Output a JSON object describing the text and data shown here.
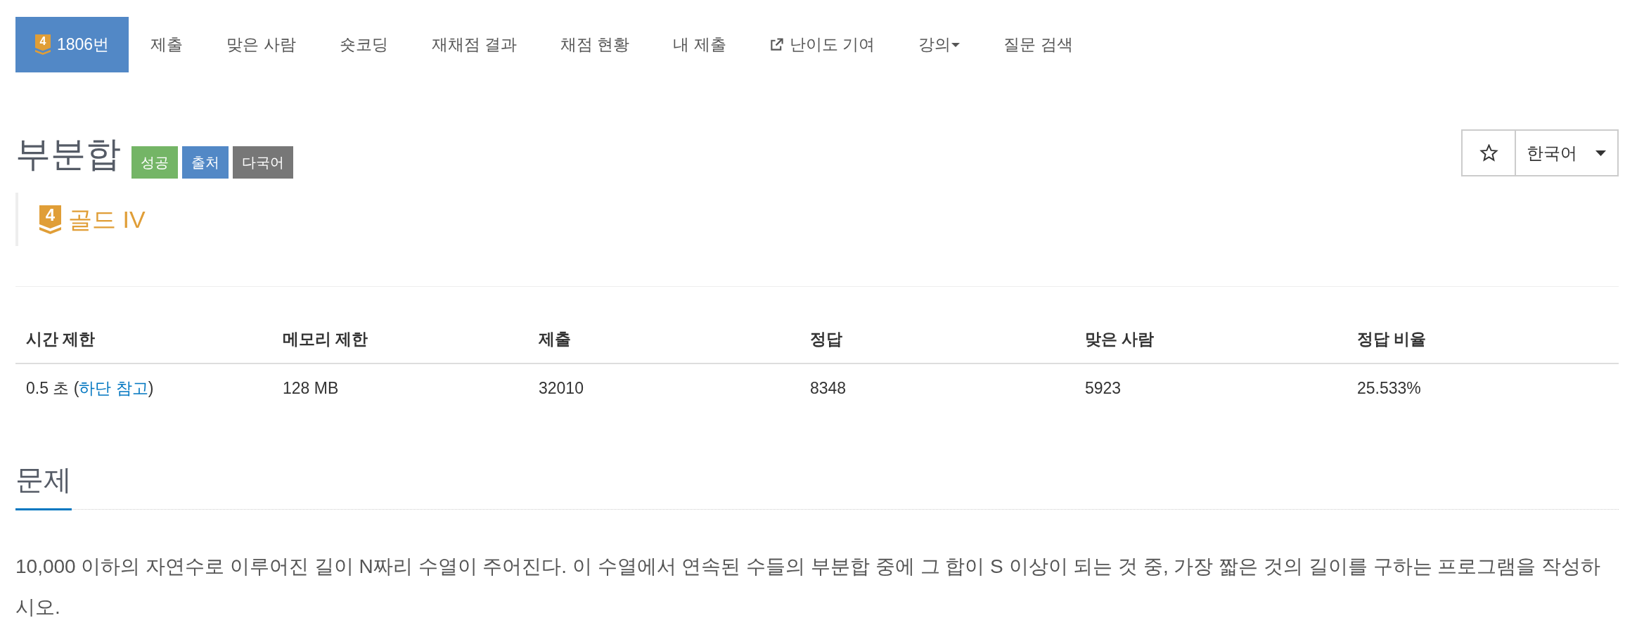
{
  "nav": {
    "items": [
      {
        "label": "1806번",
        "badge": "4",
        "kind": "problem",
        "selected": true
      },
      {
        "label": "제출",
        "kind": "link",
        "selected": false
      },
      {
        "label": "맞은 사람",
        "kind": "link",
        "selected": false
      },
      {
        "label": "숏코딩",
        "kind": "link",
        "selected": false
      },
      {
        "label": "재채점 결과",
        "kind": "link",
        "selected": false
      },
      {
        "label": "채점 현황",
        "kind": "link",
        "selected": false
      },
      {
        "label": "내 제출",
        "kind": "link",
        "selected": false
      },
      {
        "label": "난이도 기여",
        "kind": "external",
        "selected": false
      },
      {
        "label": "강의",
        "kind": "menu",
        "selected": false
      },
      {
        "label": "질문 검색",
        "kind": "link",
        "selected": false
      }
    ]
  },
  "problem": {
    "title": "부분합",
    "tags": [
      {
        "label": "성공",
        "color": "#74b566"
      },
      {
        "label": "출처",
        "color": "#5288c6"
      },
      {
        "label": "다국어",
        "color": "#777777"
      }
    ],
    "favorite": {
      "starred": false
    },
    "language": {
      "value": "한국어"
    },
    "tier": {
      "badge": "4",
      "label": "골드 IV"
    }
  },
  "limits_table": {
    "columns": [
      "시간 제한",
      "메모리 제한",
      "제출",
      "정답",
      "맞은 사람",
      "정답 비율"
    ],
    "rows": [
      {
        "cells": [
          {
            "text": "0.5 초 (",
            "link": "하단 참고",
            "after": ")"
          },
          {
            "text": "128 MB"
          },
          {
            "text": "32010"
          },
          {
            "text": "8348"
          },
          {
            "text": "5923"
          },
          {
            "text": "25.533%"
          }
        ]
      }
    ]
  },
  "section": {
    "title": "문제",
    "text": "10,000 이하의 자연수로 이루어진 길이 N짜리 수열이 주어진다. 이 수열에서 연속된 수들의 부분합 중에 그 합이 S 이상이 되는 것 중, 가장 짧은 것의 길이를 구하는 프로그램을 작성하시오."
  }
}
